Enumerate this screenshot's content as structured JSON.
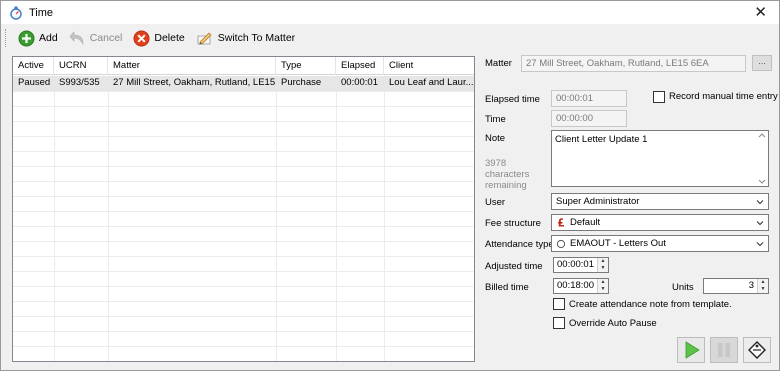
{
  "window": {
    "title": "Time",
    "close_glyph": "✕"
  },
  "toolbar": {
    "add_label": "Add",
    "cancel_label": "Cancel",
    "delete_label": "Delete",
    "switch_label": "Switch To Matter"
  },
  "grid": {
    "columns": [
      "Active",
      "UCRN",
      "Matter",
      "Type",
      "Elapsed",
      "Client"
    ],
    "rows": [
      [
        "Paused",
        "S993/535",
        "27 Mill Street, Oakham, Rutland, LE15 ...",
        "Purchase",
        "00:00:01",
        "Lou Leaf and Laur..."
      ]
    ]
  },
  "form": {
    "matter_label": "Matter",
    "matter_value": "27 Mill Street, Oakham, Rutland, LE15 6EA",
    "matter_button": "...",
    "elapsed_label": "Elapsed time",
    "elapsed_value": "00:00:01",
    "record_manual_label": "Record manual time entry",
    "time_label": "Time",
    "time_value": "00:00:00",
    "note_label": "Note",
    "note_value": "Client Letter Update 1",
    "chars_remaining": [
      "3978",
      "characters",
      "remaining"
    ],
    "user_label": "User",
    "user_value": "Super Administrator",
    "fee_label": "Fee structure",
    "fee_value": "Default",
    "attendance_label": "Attendance type",
    "attendance_value": "EMAOUT - Letters Out",
    "adjusted_label": "Adjusted time",
    "adjusted_value": "00:00:01",
    "billed_label": "Billed time",
    "billed_value": "00:18:00",
    "units_label": "Units",
    "units_value": "3",
    "create_note_label": "Create attendance note from template.",
    "override_label": "Override Auto Pause"
  },
  "colors": {
    "add_green": "#3a9c2e",
    "delete_red": "#e0401c",
    "play_green": "#5cc348",
    "row_selected": "#e6e6e6"
  },
  "icons": {
    "app": "stopwatch-icon",
    "add": "plus-circle-icon",
    "cancel": "undo-arrow-icon",
    "delete": "x-circle-icon",
    "switch": "pencil-icon",
    "play": "play-icon",
    "pause": "pause-icon",
    "tag": "tag-icon"
  }
}
